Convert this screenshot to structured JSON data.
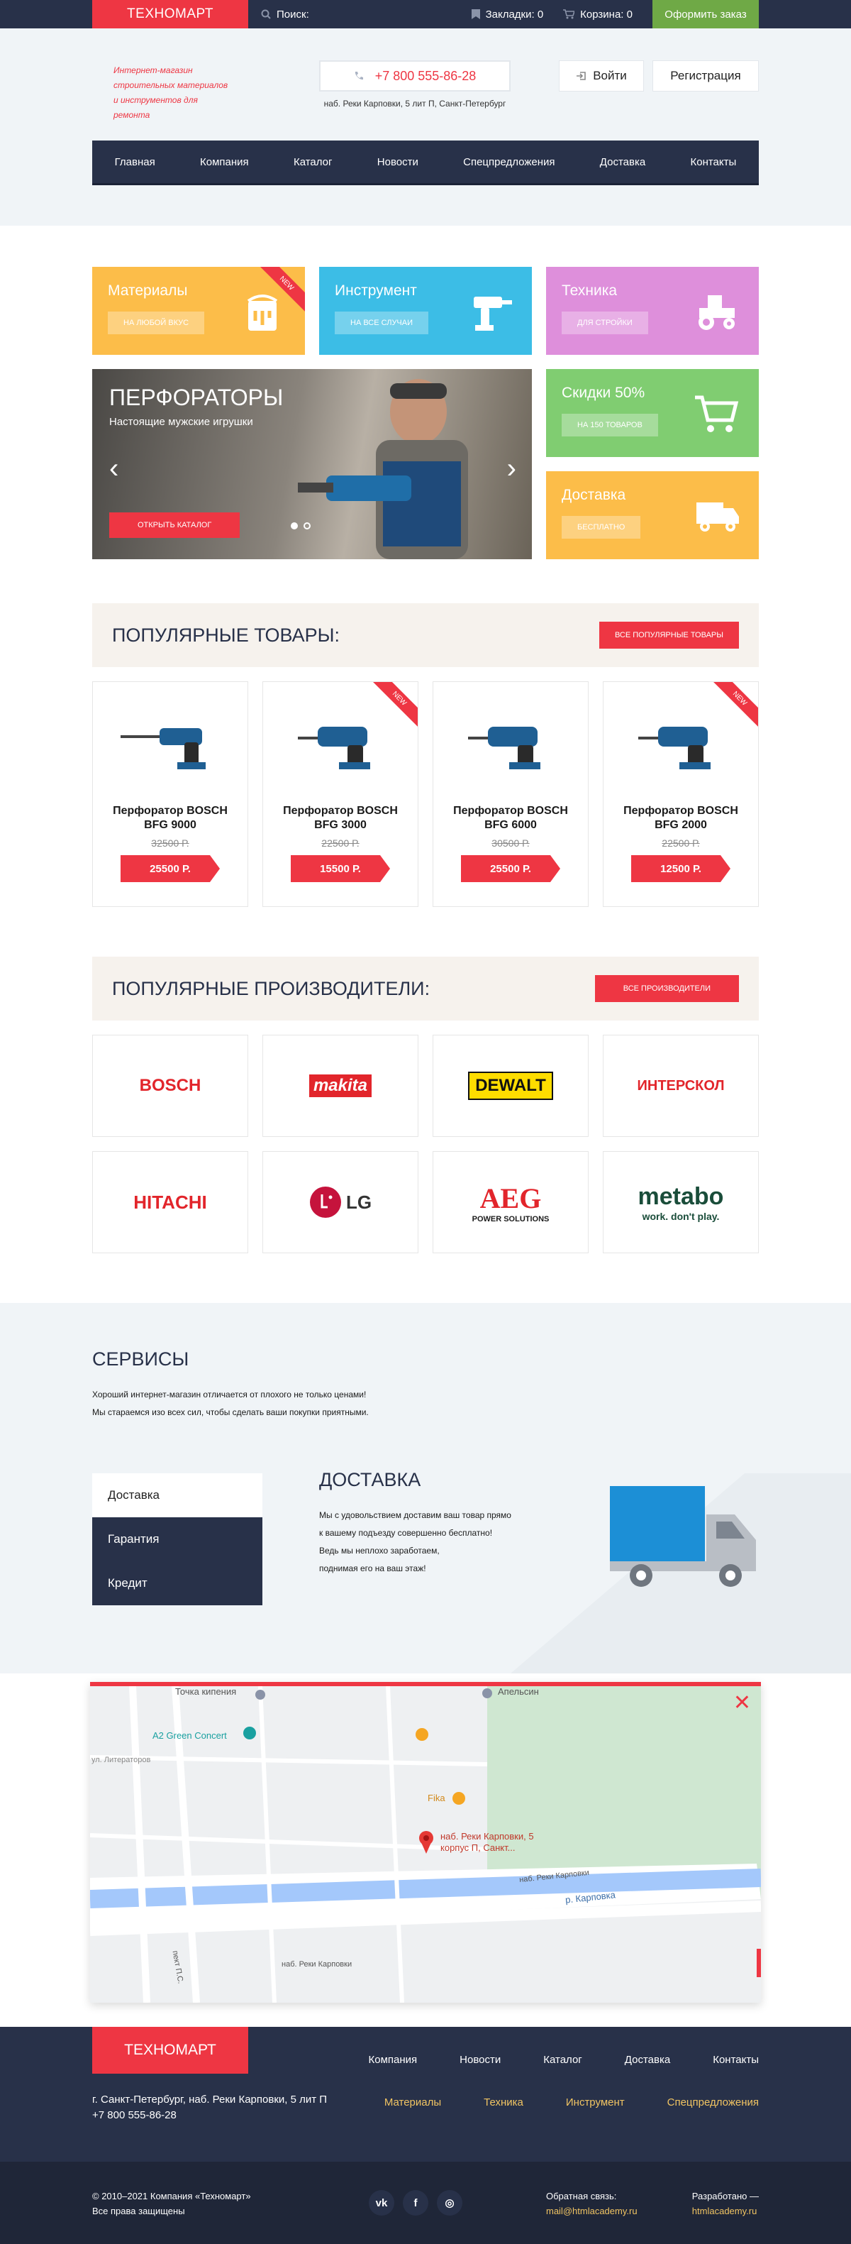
{
  "topbar": {
    "logo": "ТЕХНОМАРТ",
    "search": "Поиск:",
    "bookmarks": "Закладки: 0",
    "cart": "Корзина: 0",
    "order": "Оформить заказ"
  },
  "header": {
    "tagline": [
      "Интернет-магазин",
      "строительных материалов",
      "и инструментов для ремонта"
    ],
    "phone": "+7 800 555-86-28",
    "address": "наб. Реки Карповки, 5 лит П, Санкт-Петербург",
    "login": "Войти",
    "register": "Регистрация",
    "nav": [
      "Главная",
      "Компания",
      "Каталог",
      "Новости",
      "Спецпредложения",
      "Доставка",
      "Контакты"
    ]
  },
  "categories": [
    {
      "title": "Материалы",
      "sub": "на любой вкус",
      "color": "#fcbd49",
      "new": "NEW"
    },
    {
      "title": "Инструмент",
      "sub": "на все случаи",
      "color": "#3cbde6",
      "new": ""
    },
    {
      "title": "Техника",
      "sub": "для стройки",
      "color": "#de8fdb",
      "new": ""
    },
    {
      "title": "Скидки 50%",
      "sub": "на 150 товаров",
      "color": "#80cd71",
      "new": ""
    },
    {
      "title": "Доставка",
      "sub": "бесплатно",
      "color": "#fcbd49",
      "new": ""
    }
  ],
  "slider": {
    "title": "ПЕРФОРАТОРЫ",
    "subtitle": "Настоящие мужские игрушки",
    "cta": "Открыть каталог"
  },
  "popular": {
    "title": "ПОПУЛЯРНЫЕ ТОВАРЫ:",
    "button": "Все популярные товары"
  },
  "products": [
    {
      "name": "Перфоратор BOSCH BFG 9000",
      "old": "32500 Р.",
      "price": "25500 Р.",
      "new": false
    },
    {
      "name": "Перфоратор BOSCH BFG 3000",
      "old": "22500 Р.",
      "price": "15500 Р.",
      "new": true
    },
    {
      "name": "Перфоратор BOSCH BFG 6000",
      "old": "30500 Р.",
      "price": "25500 Р.",
      "new": false
    },
    {
      "name": "Перфоратор BOSCH BFG 2000",
      "old": "22500 Р.",
      "price": "12500 Р.",
      "new": true
    }
  ],
  "new_label": "NEW",
  "brands_head": {
    "title": "ПОПУЛЯРНЫЕ ПРОИЗВОДИТЕЛИ:",
    "button": "Все производители"
  },
  "brands": [
    "BOSCH",
    "makita",
    "DEWALT",
    "ИНТЕРСКОЛ",
    "HITACHI",
    "LG",
    "AEG",
    "metabo"
  ],
  "brand_sub": {
    "aeg": "POWER SOLUTIONS",
    "metabo": "work. don't play."
  },
  "services": {
    "title": "СЕРВИСЫ",
    "desc": [
      "Хороший интернет-магазин отличается от плохого не только ценами!",
      "Мы стараемся изо всех сил, чтобы сделать ваши покупки приятными."
    ],
    "tabs": [
      "Доставка",
      "Гарантия",
      "Кредит"
    ],
    "active_title": "ДОСТАВКА",
    "active_text": [
      "Мы с удовольствием доставим ваш товар прямо",
      "к вашему подъезду совершенно бесплатно!",
      "Ведь мы неплохо заработаем,",
      "поднимая его на ваш этаж!"
    ]
  },
  "map": {
    "labels": [
      "Точка кипения",
      "Апельсин",
      "A2 Green Concert",
      "ул. Литераторов",
      "Fika",
      "наб. Реки Карповки, 5 корпус П, Санкт...",
      "наб. Реки Карповки",
      "р. Карповка",
      "наб. Реки Карповки",
      "пект П.С."
    ]
  },
  "footer": {
    "logo": "ТЕХНОМАРТ",
    "nav1": [
      "Компания",
      "Новости",
      "Каталог",
      "Доставка",
      "Контакты"
    ],
    "nav2": [
      "Материалы",
      "Техника",
      "Инструмент",
      "Спецпредложения"
    ],
    "address": "г. Санкт-Петербург, наб. Реки Карповки, 5 лит П",
    "phone": "+7 800 555-86-28",
    "copy1": "© 2010–2021 Компания «Техномарт»",
    "copy2": "Все права защищены",
    "feedback_label": "Обратная связь:",
    "feedback_mail": "mail@htmlacademy.ru",
    "dev_label": "Разработано —",
    "dev_link": "htmlacademy.ru"
  }
}
